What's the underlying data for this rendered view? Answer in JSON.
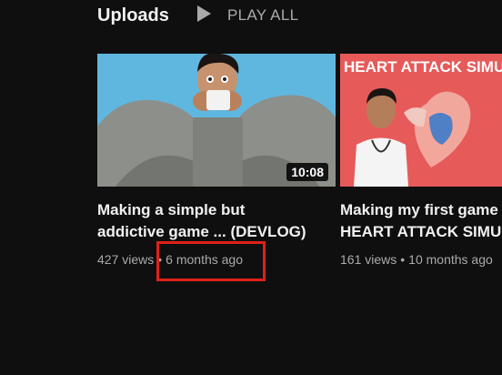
{
  "shelf": {
    "title": "Uploads",
    "play_all_label": "PLAY ALL"
  },
  "videos": [
    {
      "title_line1": "Making a simple but",
      "title_line2": "addictive game ... (DEVLOG)",
      "duration": "10:08",
      "views": "427 views",
      "separator": "•",
      "age": "6 months ago"
    },
    {
      "title_line1": "Making my first game :",
      "title_line2": "HEART ATTACK SIMUL",
      "thumb_text": "HEART ATTACK SIMU",
      "views": "161 views",
      "separator": "•",
      "age": "10 months ago"
    }
  ],
  "colors": {
    "background": "#0f0f0f",
    "highlight": "#e0201a",
    "thumb1_bg": "#5fb7e0",
    "thumb2_bg": "#e65a59"
  }
}
